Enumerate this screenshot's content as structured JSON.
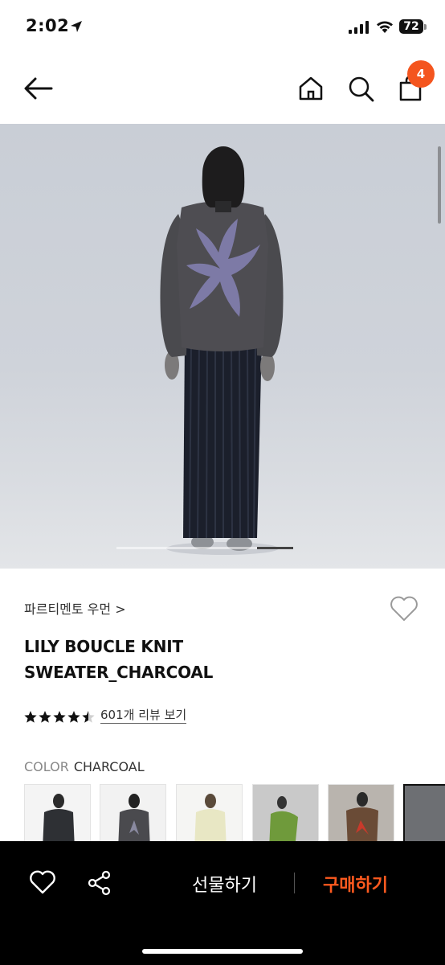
{
  "status_bar": {
    "time": "2:02",
    "battery": "72"
  },
  "header": {
    "cart_count": "4"
  },
  "product": {
    "brand": "파르티멘토 우먼 >",
    "title": "LILY BOUCLE KNIT SWEATER_CHARCOAL",
    "rating": 4.5,
    "reviews": "601개 리뷰 보기",
    "color_label": "COLOR",
    "color_value": "CHARCOAL",
    "image_count": 5,
    "image_index": 5
  },
  "thumbnails": [
    {
      "name": "thumb-charcoal-front"
    },
    {
      "name": "thumb-charcoal-back"
    },
    {
      "name": "thumb-cream-front"
    },
    {
      "name": "thumb-green-back"
    },
    {
      "name": "thumb-brown-back"
    },
    {
      "name": "thumb-more"
    }
  ],
  "bottom_bar": {
    "gift_label": "선물하기",
    "buy_label": "구매하기"
  },
  "colors": {
    "accent": "#f4551e",
    "buy": "#ff5a1f"
  }
}
